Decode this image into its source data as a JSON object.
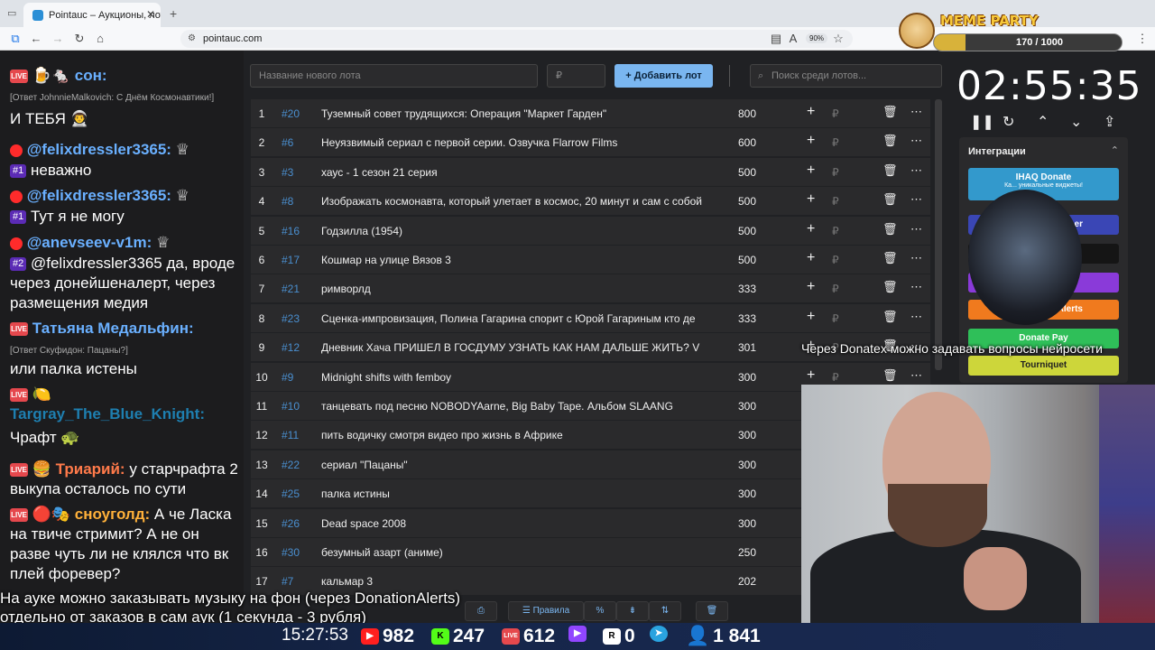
{
  "browser": {
    "tab_title": "Pointauc – Аукционы, лотереи",
    "url": "pointauc.com",
    "zoom": "90%"
  },
  "meme_party": {
    "title": "MEME PARTY",
    "count": "170 / 1000",
    "progress": 0.17
  },
  "chat": {
    "messages": [
      {
        "nick": "сон:",
        "reply": "",
        "text": ""
      },
      {
        "nick": "",
        "reply": "[Ответ JohnnieMalkovich: С Днём Космонавтики!]",
        "text": "И ТЕБЯ"
      },
      {
        "nick": "@felixdressler3365:",
        "reply": "",
        "text": "неважно"
      },
      {
        "nick": "@felixdressler3365:",
        "reply": "",
        "text": "Тут я не могу"
      },
      {
        "nick": "@anevseev-v1m:",
        "reply": "",
        "text": "@felixdressler3365 да, вроде через донейшеналерт, через размещения медия"
      },
      {
        "nick": "Татьяна Медальфин:",
        "reply": "[Ответ Скуфидон: Пацаны?]",
        "text": "или палка истены"
      },
      {
        "nick": "Targray_The_Blue_Knight:",
        "reply": "",
        "text": "Чрафт"
      },
      {
        "nick": "Триарий:",
        "reply": "",
        "text": "у старчрафта 2 выкупа осталось по сути"
      },
      {
        "nick": "сноуголд:",
        "reply": "",
        "text": "А че Ласка на твиче стримит? А не он разве чуть ли не клялся что вк плей форевер?"
      }
    ],
    "badges": {
      "b1": "#1",
      "b2": "#1",
      "b3": "#2"
    }
  },
  "lots": {
    "name_placeholder": "Название нового лота",
    "price_placeholder": "₽",
    "add_label": "Добавить лот",
    "search_placeholder": "Поиск среди лотов...",
    "rows": [
      {
        "idx": "1",
        "num": "#20",
        "name": "Туземный совет трудящихся: Операция \"Маркет Гарден\"",
        "amount": "800"
      },
      {
        "idx": "2",
        "num": "#6",
        "name": "Неуязвимый сериал с первой серии. Озвучка Flarrow Films",
        "amount": "600"
      },
      {
        "idx": "3",
        "num": "#3",
        "name": "хаус - 1 сезон 21 серия",
        "amount": "500"
      },
      {
        "idx": "4",
        "num": "#8",
        "name": "Изображать космонавта, который улетает в космос, 20 минут и сам с собой",
        "amount": "500"
      },
      {
        "idx": "5",
        "num": "#16",
        "name": "Годзилла (1954)",
        "amount": "500"
      },
      {
        "idx": "6",
        "num": "#17",
        "name": "Кошмар на улице Вязов 3",
        "amount": "500"
      },
      {
        "idx": "7",
        "num": "#21",
        "name": "римворлд",
        "amount": "333"
      },
      {
        "idx": "8",
        "num": "#23",
        "name": "Сценка-импровизация, Полина Гагарина спорит с Юрой Гагариным кто де",
        "amount": "333"
      },
      {
        "idx": "9",
        "num": "#12",
        "name": "Дневник Хача ПРИШЕЛ В ГОСДУМУ УЗНАТЬ КАК НАМ ДАЛЬШЕ ЖИТЬ? V",
        "amount": "301"
      },
      {
        "idx": "10",
        "num": "#9",
        "name": "Midnight shifts with femboy",
        "amount": "300"
      },
      {
        "idx": "11",
        "num": "#10",
        "name": "танцевать под песню NOBODYAarne, Big Baby Tape. Альбом SLAANG",
        "amount": "300"
      },
      {
        "idx": "12",
        "num": "#11",
        "name": "пить водичку смотря видео про жизнь в Африке",
        "amount": "300"
      },
      {
        "idx": "13",
        "num": "#22",
        "name": "сериал \"Пацаны\"",
        "amount": "300"
      },
      {
        "idx": "14",
        "num": "#25",
        "name": "палка истины",
        "amount": "300"
      },
      {
        "idx": "15",
        "num": "#26",
        "name": "Dead space 2008",
        "amount": "300"
      },
      {
        "idx": "16",
        "num": "#30",
        "name": "безумный азарт (аниме)",
        "amount": "250"
      },
      {
        "idx": "17",
        "num": "#7",
        "name": "кальмар 3",
        "amount": "202"
      }
    ]
  },
  "timer": {
    "value": "02:55:35"
  },
  "integrations": {
    "title": "Интеграции",
    "ihaq": "IHAQ Donate",
    "ihaq_sub": "Ка... уникальные виджеты!",
    "er": "er",
    "alerts": "Alerts",
    "donatepay": "Donate Pay",
    "tourniquet": "Tourniquet"
  },
  "controls": {
    "rules": "Правила",
    "percent": "%"
  },
  "overlay": {
    "line1": "На ауке можно заказывать музыку на фон (через DonationAlerts)",
    "line2": "отдельно от заказов в сам аук (1 секунда - 3 рубля)",
    "ticker": "Через Donatex можно задавать вопросы нейросети"
  },
  "stats": {
    "time": "15:27:53",
    "youtube": "982",
    "kick": "247",
    "vk": "612",
    "rumble": "0",
    "telegram": "",
    "viewers": "1 841"
  }
}
